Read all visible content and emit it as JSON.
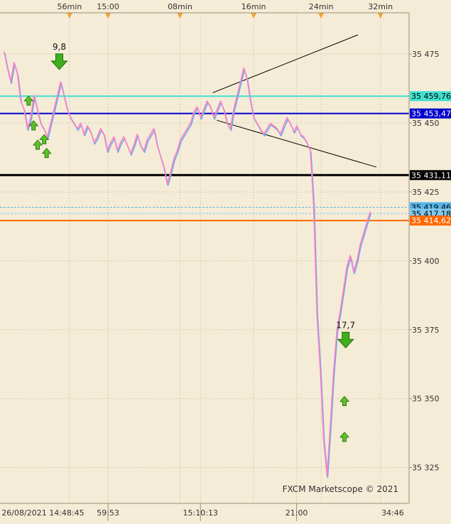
{
  "chart_data": {
    "type": "line",
    "series": [
      {
        "values": [
          35476,
          35470,
          35465,
          35472,
          35468,
          35458,
          35455,
          35448,
          35452,
          35460,
          35455,
          35450,
          35448,
          35445,
          35450,
          35455,
          35460,
          35465,
          35460,
          35455,
          35452,
          35450,
          35448,
          35450,
          35446,
          35449,
          35447,
          35443,
          35445,
          35448,
          35446,
          35440,
          35443,
          35445,
          35440,
          35443,
          35445,
          35442,
          35439,
          35442,
          35446,
          35442,
          35440,
          35444,
          35446,
          35448,
          35442,
          35438,
          35434,
          35428,
          35432,
          35437,
          35440,
          35444,
          35446,
          35448,
          35450,
          35454,
          35456,
          35452,
          35455,
          35458,
          35456,
          35452,
          35455,
          35458,
          35455,
          35450,
          35448,
          35455,
          35460,
          35465,
          35470,
          35466,
          35458,
          35452,
          35450,
          35448,
          35446,
          35448,
          35450,
          35449,
          35448,
          35446,
          35449,
          35452,
          35450,
          35447,
          35449,
          35446,
          35445,
          35443,
          35440,
          35420,
          35380,
          35360,
          35335,
          35322,
          35340,
          35360,
          35375,
          35382,
          35390,
          35398,
          35402,
          35396,
          35400,
          35406,
          35410,
          35414,
          35418
        ],
        "color": "#FF80C8"
      }
    ],
    "y_ticks": [
      {
        "value": 35475,
        "label": "35 475"
      },
      {
        "value": 35450,
        "label": "35 450"
      },
      {
        "value": 35425,
        "label": "35 425"
      },
      {
        "value": 35400,
        "label": "35 400"
      },
      {
        "value": 35375,
        "label": "35 375"
      },
      {
        "value": 35350,
        "label": "35 350"
      },
      {
        "value": 35325,
        "label": "35 325"
      }
    ],
    "ylim": [
      35312,
      35490
    ],
    "top_labels": [
      {
        "label": "56min",
        "pos": 0.17
      },
      {
        "label": "15:00",
        "pos": 0.264
      },
      {
        "label": "08min",
        "pos": 0.44
      },
      {
        "label": "16min",
        "pos": 0.62
      },
      {
        "label": "24min",
        "pos": 0.785
      },
      {
        "label": "32min",
        "pos": 0.93
      }
    ],
    "bottom_labels": [
      {
        "label": "26/08/2021 14:48:45",
        "pos": 0.105,
        "divider": false
      },
      {
        "label": "59:53",
        "pos": 0.264,
        "divider": true
      },
      {
        "label": "15:10:13",
        "pos": 0.49,
        "divider": true
      },
      {
        "label": "21:00",
        "pos": 0.725,
        "divider": true
      },
      {
        "label": "34:46",
        "pos": 0.96,
        "divider": false
      }
    ],
    "horizontal_lines": [
      {
        "value": 35459.76,
        "label": "35 459,76",
        "color": "#40E0D0",
        "text_color": "#000000",
        "width": 2,
        "dashed": false
      },
      {
        "value": 35453.47,
        "label": "35 453,47",
        "color": "#0000CC",
        "text_color": "#FFFFFF",
        "width": 2,
        "dashed": false
      },
      {
        "value": 35431.11,
        "label": "35 431,11",
        "color": "#000000",
        "text_color": "#FFFFFF",
        "width": 3,
        "dashed": false
      },
      {
        "value": 35419.46,
        "label": "35 419,46",
        "color": "#56B4E9",
        "text_color": "#000000",
        "width": 1,
        "dashed": true
      },
      {
        "value": 35417.18,
        "label": "35 417,18",
        "color": "#7EC8F0",
        "text_color": "#000000",
        "width": 1,
        "dashed": true
      },
      {
        "value": 35414.62,
        "label": "35 414,62",
        "color": "#FF6600",
        "text_color": "#FFFFFF",
        "width": 2,
        "dashed": false
      }
    ],
    "trend_lines": [
      {
        "from": [
          0.52,
          35461
        ],
        "to": [
          0.875,
          35482
        ]
      },
      {
        "from": [
          0.53,
          35451
        ],
        "to": [
          0.92,
          35434
        ]
      }
    ],
    "annotations": [
      {
        "label": "9,8",
        "pos": 0.145,
        "value": 35474
      },
      {
        "label": "17,7",
        "pos": 0.845,
        "value": 35373
      }
    ],
    "arrows_up": [
      {
        "pos": 0.07,
        "value": 35458
      },
      {
        "pos": 0.082,
        "value": 35449
      },
      {
        "pos": 0.092,
        "value": 35442
      },
      {
        "pos": 0.108,
        "value": 35444
      },
      {
        "pos": 0.114,
        "value": 35439
      },
      {
        "pos": 0.842,
        "value": 35349
      },
      {
        "pos": 0.842,
        "value": 35336
      }
    ],
    "arrows_down": [
      {
        "pos": 0.145,
        "value": 35472
      },
      {
        "pos": 0.845,
        "value": 35371
      }
    ],
    "watermark": "FXCM Marketscope © 2021"
  }
}
